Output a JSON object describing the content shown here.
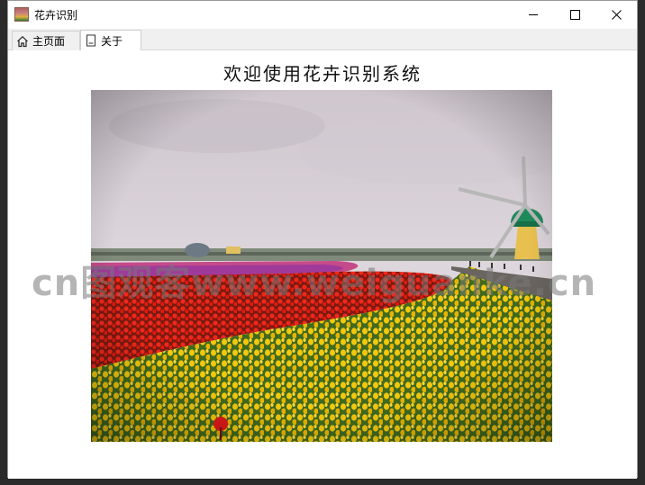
{
  "window": {
    "title": "花卉识别",
    "icon": "flower-photo-icon"
  },
  "tabs": [
    {
      "label": "主页面",
      "icon": "home-icon",
      "active": false
    },
    {
      "label": "关于",
      "icon": "document-icon",
      "active": true
    }
  ],
  "content": {
    "heading": "欢迎使用花卉识别系统",
    "watermark": "cn图观客www.weiguanke.cn"
  },
  "colors": {
    "tulip_red": "#e8201a",
    "tulip_yellow": "#f2c40a",
    "sky": "#d9d2d8",
    "windmill_green": "#1e8a5a"
  }
}
